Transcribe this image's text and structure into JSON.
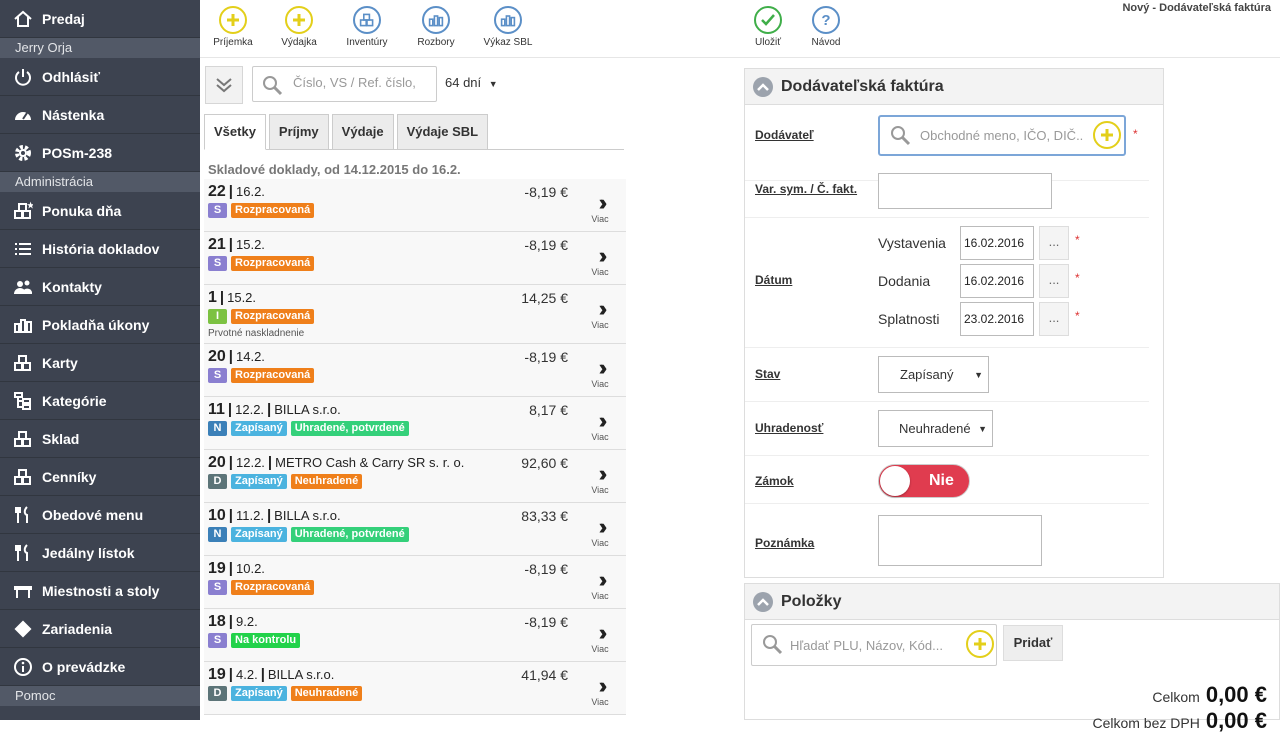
{
  "window_title": "Nový - Dodávateľská faktúra",
  "sidebar": {
    "user": "Jerry Orja",
    "admin_section": "Administrácia",
    "help_section": "Pomoc",
    "top_items": [
      {
        "label": "Predaj",
        "icon": "home-icon"
      },
      {
        "label": "Odhlásiť",
        "icon": "power-icon"
      },
      {
        "label": "Nástenka",
        "icon": "dashboard-icon"
      },
      {
        "label": "POSm-238",
        "icon": "gear-icon"
      }
    ],
    "admin_items": [
      {
        "label": "Ponuka dňa",
        "icon": "boxes-star-icon"
      },
      {
        "label": "História dokladov",
        "icon": "list-icon"
      },
      {
        "label": "Kontakty",
        "icon": "users-icon"
      },
      {
        "label": "Pokladňa úkony",
        "icon": "bars-icon"
      },
      {
        "label": "Karty",
        "icon": "boxes-icon"
      },
      {
        "label": "Kategórie",
        "icon": "tree-icon"
      },
      {
        "label": "Sklad",
        "icon": "boxes-icon"
      },
      {
        "label": "Cenníky",
        "icon": "boxes-icon"
      },
      {
        "label": "Obedové menu",
        "icon": "cutlery-icon"
      },
      {
        "label": "Jedálny lístok",
        "icon": "cutlery-icon"
      },
      {
        "label": "Miestnosti a stoly",
        "icon": "table-icon"
      },
      {
        "label": "Zariadenia",
        "icon": "diamond-icon"
      },
      {
        "label": "O prevádzke",
        "icon": "info-icon"
      }
    ]
  },
  "toolbar": {
    "buttons": [
      {
        "label": "Príjemka",
        "icon": "plus-icon"
      },
      {
        "label": "Výdajka",
        "icon": "plus-icon"
      },
      {
        "label": "Inventúry",
        "icon": "boxes-icon"
      },
      {
        "label": "Rozbory",
        "icon": "bars-icon"
      },
      {
        "label": "Výkaz SBL",
        "icon": "bars-icon"
      },
      {
        "label": "Uložiť",
        "icon": "check-icon"
      },
      {
        "label": "Návod",
        "icon": "question-icon"
      }
    ]
  },
  "list": {
    "search_placeholder": "Číslo, VS / Ref. číslo,",
    "days_filter": "64 dní",
    "tabs": [
      "Všetky",
      "Príjmy",
      "Výdaje",
      "Výdaje SBL"
    ],
    "active_tab": "Všetky",
    "heading": "Skladové doklady, od 14.12.2015 do 16.2.",
    "more_label": "Viac",
    "docs": [
      {
        "num": "22",
        "date": "16.2.",
        "partner": "",
        "amount": "-8,19 €",
        "type": "S",
        "type_color": "#8a7fd0",
        "badges": [
          {
            "text": "Rozpracovaná",
            "color": "#ef7f1a"
          }
        ],
        "note": ""
      },
      {
        "num": "21",
        "date": "15.2.",
        "partner": "",
        "amount": "-8,19 €",
        "type": "S",
        "type_color": "#8a7fd0",
        "badges": [
          {
            "text": "Rozpracovaná",
            "color": "#ef7f1a"
          }
        ],
        "note": ""
      },
      {
        "num": "1",
        "date": "15.2.",
        "partner": "",
        "amount": "14,25 €",
        "type": "I",
        "type_color": "#7cc242",
        "badges": [
          {
            "text": "Rozpracovaná",
            "color": "#ef7f1a"
          }
        ],
        "note": "Prvotné naskladnenie"
      },
      {
        "num": "20",
        "date": "14.2.",
        "partner": "",
        "amount": "-8,19 €",
        "type": "S",
        "type_color": "#8a7fd0",
        "badges": [
          {
            "text": "Rozpracovaná",
            "color": "#ef7f1a"
          }
        ],
        "note": ""
      },
      {
        "num": "11",
        "date": "12.2.",
        "partner": "BILLA s.r.o.",
        "amount": "8,17 €",
        "type": "N",
        "type_color": "#3b80b8",
        "badges": [
          {
            "text": "Zapísaný",
            "color": "#4bb3df"
          },
          {
            "text": "Uhradené, potvrdené",
            "color": "#34d07a"
          }
        ],
        "note": ""
      },
      {
        "num": "20",
        "date": "12.2.",
        "partner": "METRO Cash & Carry SR s. r. o.",
        "amount": "92,60 €",
        "type": "D",
        "type_color": "#5c7478",
        "badges": [
          {
            "text": "Zapísaný",
            "color": "#4bb3df"
          },
          {
            "text": "Neuhradené",
            "color": "#ef7f1a"
          }
        ],
        "note": ""
      },
      {
        "num": "10",
        "date": "11.2.",
        "partner": "BILLA s.r.o.",
        "amount": "83,33 €",
        "type": "N",
        "type_color": "#3b80b8",
        "badges": [
          {
            "text": "Zapísaný",
            "color": "#4bb3df"
          },
          {
            "text": "Uhradené, potvrdené",
            "color": "#34d07a"
          }
        ],
        "note": ""
      },
      {
        "num": "19",
        "date": "10.2.",
        "partner": "",
        "amount": "-8,19 €",
        "type": "S",
        "type_color": "#8a7fd0",
        "badges": [
          {
            "text": "Rozpracovaná",
            "color": "#ef7f1a"
          }
        ],
        "note": ""
      },
      {
        "num": "18",
        "date": "9.2.",
        "partner": "",
        "amount": "-8,19 €",
        "type": "S",
        "type_color": "#8a7fd0",
        "badges": [
          {
            "text": "Na kontrolu",
            "color": "#22d24a"
          }
        ],
        "note": ""
      },
      {
        "num": "19",
        "date": "4.2.",
        "partner": "BILLA s.r.o.",
        "amount": "41,94 €",
        "type": "D",
        "type_color": "#5c7478",
        "badges": [
          {
            "text": "Zapísaný",
            "color": "#4bb3df"
          },
          {
            "text": "Neuhradené",
            "color": "#ef7f1a"
          }
        ],
        "note": ""
      }
    ]
  },
  "form": {
    "title": "Dodávateľská faktúra",
    "supplier_label": "Dodávateľ",
    "supplier_placeholder": "Obchodné meno, IČO, DIČ..",
    "varsym_label": "Var. sym. / Č. fakt.",
    "varsym_value": "",
    "date_label": "Dátum",
    "issued_label": "Vystavenia",
    "issued_value": "16.02.2016",
    "delivered_label": "Dodania",
    "delivered_value": "16.02.2016",
    "due_label": "Splatnosti",
    "due_value": "23.02.2016",
    "dots": "...",
    "required_mark": "*",
    "status_label": "Stav",
    "status_value": "Zapísaný",
    "payment_label": "Uhradenosť",
    "payment_value": "Neuhradené",
    "lock_label": "Zámok",
    "lock_value": "Nie",
    "note_label": "Poznámka",
    "note_value": ""
  },
  "items": {
    "title": "Položky",
    "search_placeholder": "Hľadať PLU, Názov, Kód...",
    "add_label": "Pridať",
    "total_label": "Celkom",
    "total_value": "0,00 €",
    "vat_label": "Celkom bez DPH",
    "vat_value": "0,00 €"
  },
  "colors": {
    "sidebar_bg": "#3d4350",
    "sidebar_section": "#525967",
    "accent_blue": "#5b8fc7",
    "accent_yellow": "#e3cf1a",
    "save_green": "#3fae49",
    "toggle_red": "#e03c4f",
    "required": "#dd3333"
  }
}
